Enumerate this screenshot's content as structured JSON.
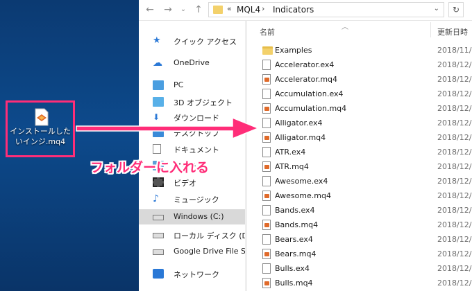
{
  "desktop": {
    "file_label": "インストールしたいインジ.mq4",
    "file_icon": "mq4-file-icon"
  },
  "window": {
    "address": {
      "overflow": "«",
      "segments": [
        "MQL4",
        "Indicators"
      ]
    }
  },
  "nav": {
    "items": [
      {
        "label": "クイック アクセス",
        "icon": "star-icon"
      },
      {
        "label": "OneDrive",
        "icon": "cloud-icon"
      },
      {
        "label": "PC",
        "icon": "monitor-icon"
      },
      {
        "label": "3D オブジェクト",
        "icon": "cube-icon"
      },
      {
        "label": "ダウンロード",
        "icon": "download-icon"
      },
      {
        "label": "デスクトップ",
        "icon": "desktop-icon"
      },
      {
        "label": "ドキュメント",
        "icon": "document-icon"
      },
      {
        "label": "ピクチャ",
        "icon": "picture-icon"
      },
      {
        "label": "ビデオ",
        "icon": "video-icon"
      },
      {
        "label": "ミュージック",
        "icon": "music-icon"
      },
      {
        "label": "Windows (C:)",
        "icon": "drive-icon"
      },
      {
        "label": "ローカル ディスク (D:)",
        "icon": "drive-icon"
      },
      {
        "label": "Google Drive File St",
        "icon": "drive-icon"
      },
      {
        "label": "ネットワーク",
        "icon": "network-icon"
      }
    ],
    "selected": "Windows (C:)"
  },
  "list": {
    "columns": {
      "name": "名前",
      "date": "更新日時"
    },
    "rows": [
      {
        "name": "Examples",
        "date": "2018/11/",
        "type": "folder"
      },
      {
        "name": "Accelerator.ex4",
        "date": "2018/12/",
        "type": "ex4"
      },
      {
        "name": "Accelerator.mq4",
        "date": "2018/12/",
        "type": "mq4"
      },
      {
        "name": "Accumulation.ex4",
        "date": "2018/12/",
        "type": "ex4"
      },
      {
        "name": "Accumulation.mq4",
        "date": "2018/12/",
        "type": "mq4"
      },
      {
        "name": "Alligator.ex4",
        "date": "2018/12/",
        "type": "ex4"
      },
      {
        "name": "Alligator.mq4",
        "date": "2018/12/",
        "type": "mq4"
      },
      {
        "name": "ATR.ex4",
        "date": "2018/12/",
        "type": "ex4"
      },
      {
        "name": "ATR.mq4",
        "date": "2018/12/",
        "type": "mq4"
      },
      {
        "name": "Awesome.ex4",
        "date": "2018/12/",
        "type": "ex4"
      },
      {
        "name": "Awesome.mq4",
        "date": "2018/12/",
        "type": "mq4"
      },
      {
        "name": "Bands.ex4",
        "date": "2018/12/",
        "type": "ex4"
      },
      {
        "name": "Bands.mq4",
        "date": "2018/12/",
        "type": "mq4"
      },
      {
        "name": "Bears.ex4",
        "date": "2018/12/",
        "type": "ex4"
      },
      {
        "name": "Bears.mq4",
        "date": "2018/12/",
        "type": "mq4"
      },
      {
        "name": "Bulls.ex4",
        "date": "2018/12/",
        "type": "ex4"
      },
      {
        "name": "Bulls.mq4",
        "date": "2018/12/",
        "type": "mq4"
      }
    ]
  },
  "annotation": {
    "text": "フォルダーに入れる",
    "color": "#ff2d78"
  }
}
